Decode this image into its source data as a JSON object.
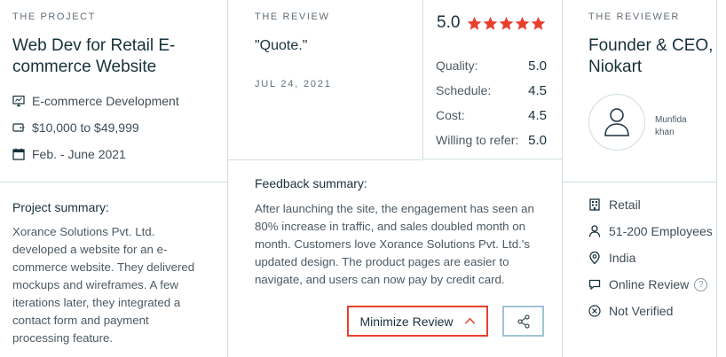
{
  "project": {
    "eyebrow": "THE PROJECT",
    "title_line1": "Web Dev for Retail E-",
    "title_line2": "commerce Website",
    "service": "E-commerce Development",
    "budget": "$10,000 to $49,999",
    "timeline": "Feb. - June 2021",
    "summary_label": "Project summary:",
    "summary_lines": [
      "Xorance Solutions Pvt. Ltd.",
      "developed a website for an e-",
      "commerce website. They delivered",
      "mockups and wireframes. A few",
      "iterations later, they integrated a",
      "contact form and payment",
      "processing feature."
    ]
  },
  "review": {
    "eyebrow": "THE REVIEW",
    "quote": "\"Quote.\"",
    "date": "JUL 24, 2021",
    "overall": "5.0",
    "star_count": 5,
    "scores": [
      {
        "label": "Quality:",
        "value": "5.0"
      },
      {
        "label": "Schedule:",
        "value": "4.5"
      },
      {
        "label": "Cost:",
        "value": "4.5"
      },
      {
        "label": "Willing to refer:",
        "value": "5.0"
      }
    ],
    "feedback_label": "Feedback summary:",
    "feedback_lines": [
      "After launching the site, the engagement has seen an",
      "80% increase in traffic, and sales doubled month on",
      "month. Customers love Xorance Solutions Pvt. Ltd.'s",
      "updated design. The product pages are easier to",
      "navigate, and users can now pay by credit card."
    ],
    "minimize_label": "Minimize Review"
  },
  "reviewer": {
    "eyebrow": "THE REVIEWER",
    "title_line1": "Founder & CEO,",
    "title_line2": "Niokart",
    "name_line1": "Munfida",
    "name_line2": "khan",
    "industry": "Retail",
    "employees": "51-200 Employees",
    "location": "India",
    "review_type": "Online Review",
    "help_symbol": "?",
    "verification": "Not Verified"
  },
  "colors": {
    "accent_red": "#e8402e",
    "star": "#e8402e",
    "divider": "#cfdde0",
    "share_border": "#9fc4d3"
  }
}
